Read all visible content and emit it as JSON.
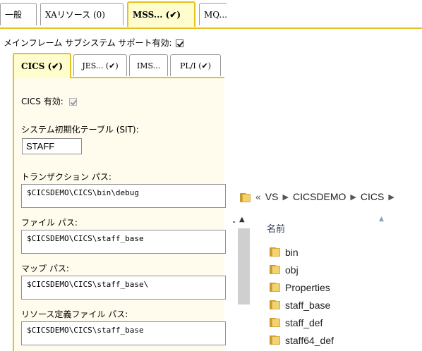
{
  "top_tabs": [
    {
      "label": "一般"
    },
    {
      "label": "XAリソース (0)"
    },
    {
      "label": "MSS... (✔)",
      "active": true
    },
    {
      "label": "MQ..."
    }
  ],
  "mainframe": {
    "label": "メインフレーム サブシステム サポート有効:",
    "checked": true
  },
  "inner_tabs": [
    {
      "label": "CICS (✔)",
      "active": true
    },
    {
      "label": "JES... (✔)"
    },
    {
      "label": "IMS..."
    },
    {
      "label": "PL/I (✔)"
    }
  ],
  "cics": {
    "enabled_label": "CICS 有効:",
    "enabled_checked": true,
    "sit_label": "システム初期化テーブル (SIT):",
    "sit_value": "STAFF",
    "transaction_path_label": "トランザクション パス:",
    "transaction_path_value": "$CICSDEMO\\CICS\\bin\\debug",
    "file_path_label": "ファイル パス:",
    "file_path_value": "$CICSDEMO\\CICS\\staff_base",
    "map_path_label": "マップ パス:",
    "map_path_value": "$CICSDEMO\\CICS\\staff_base\\",
    "resource_file_path_label": "リソース定義ファイル パス:",
    "resource_file_path_value": "$CICSDEMO\\CICS\\staff_base"
  },
  "explorer": {
    "breadcrumb": [
      "VS",
      "CICSDEMO",
      "CICS"
    ],
    "column_header": "名前",
    "items": [
      "bin",
      "obj",
      "Properties",
      "staff_base",
      "staff_def",
      "staff64_def"
    ]
  }
}
